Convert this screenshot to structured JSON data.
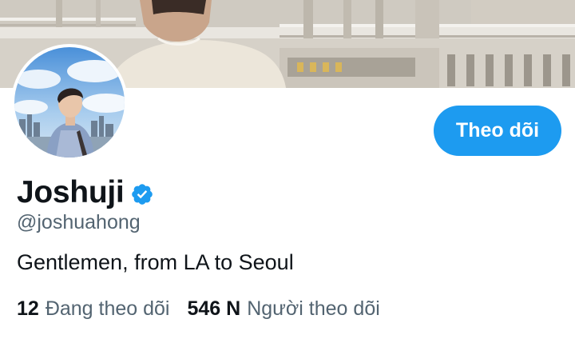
{
  "profile": {
    "display_name": "Joshuji",
    "handle": "@joshuahong",
    "bio": "Gentlemen, from LA to Seoul",
    "verified_icon": "verified-badge-icon"
  },
  "actions": {
    "follow_label": "Theo dõi"
  },
  "stats": {
    "following_count": "12",
    "following_label": "Đang theo dõi",
    "followers_count": "546 N",
    "followers_label": "Người theo dõi"
  },
  "colors": {
    "accent": "#1d9bf0",
    "text_primary": "#0f1419",
    "text_secondary": "#536471",
    "background": "#ffffff"
  }
}
